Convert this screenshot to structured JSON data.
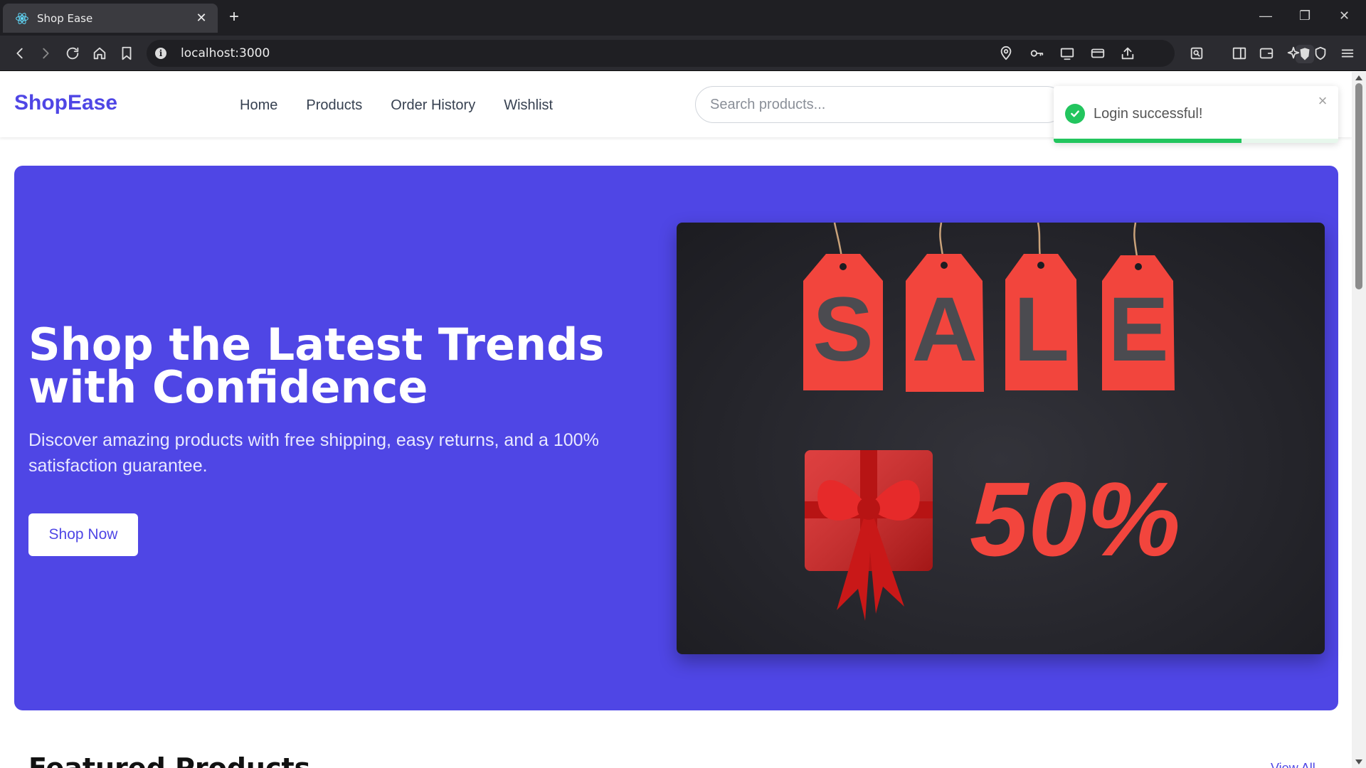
{
  "browser": {
    "tab_title": "Shop Ease",
    "tab_favicon": "react-icon",
    "url": "localhost:3000"
  },
  "header": {
    "brand": "ShopEase",
    "nav": [
      "Home",
      "Products",
      "Order History",
      "Wishlist"
    ],
    "search_placeholder": "Search products..."
  },
  "toast": {
    "message": "Login successful!",
    "status_color": "#22c55e",
    "progress_percent": 66
  },
  "hero": {
    "title": "Shop the Latest Trends with Confidence",
    "subtitle": "Discover amazing products with free shipping, easy returns, and a 100% satisfaction guarantee.",
    "button": "Shop Now",
    "image": {
      "tags": [
        "S",
        "A",
        "L",
        "E"
      ],
      "discount": "50%"
    }
  },
  "featured": {
    "title": "Featured Products",
    "link": "View All"
  },
  "colors": {
    "brand": "#4f46e5",
    "sale_red": "#f2453d",
    "success": "#22c55e"
  }
}
